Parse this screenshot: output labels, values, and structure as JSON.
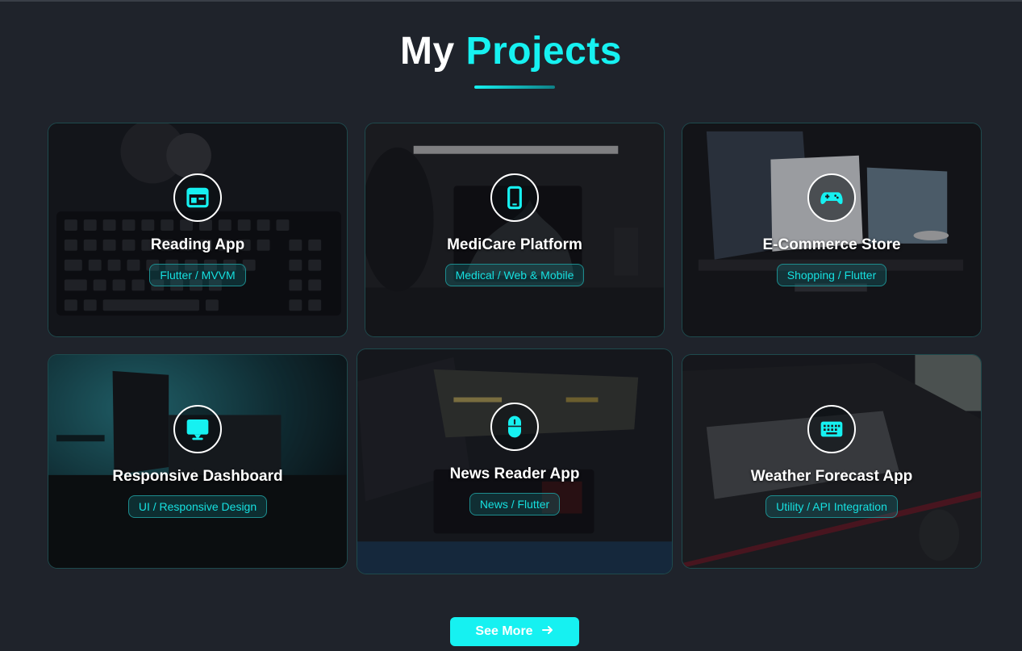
{
  "header": {
    "title_prefix": "My",
    "title_accent": "Projects"
  },
  "projects": [
    {
      "title": "Reading App",
      "tag": "Flutter / MVVM",
      "icon": "window-icon"
    },
    {
      "title": "MediCare Platform",
      "tag": "Medical / Web & Mobile",
      "icon": "smartphone-icon"
    },
    {
      "title": "E-Commerce Store",
      "tag": "Shopping / Flutter",
      "icon": "gamepad-icon"
    },
    {
      "title": "Responsive Dashboard",
      "tag": "UI / Responsive Design",
      "icon": "monitor-icon"
    },
    {
      "title": "News Reader App",
      "tag": "News / Flutter",
      "icon": "mouse-icon"
    },
    {
      "title": "Weather Forecast App",
      "tag": "Utility / API Integration",
      "icon": "keyboard-icon"
    }
  ],
  "footer": {
    "see_more_label": "See More",
    "see_more_icon": "arrow-right-icon"
  },
  "colors": {
    "accent": "#16f1f1",
    "background": "#1f232b",
    "card_border": "#1e4a4d"
  }
}
